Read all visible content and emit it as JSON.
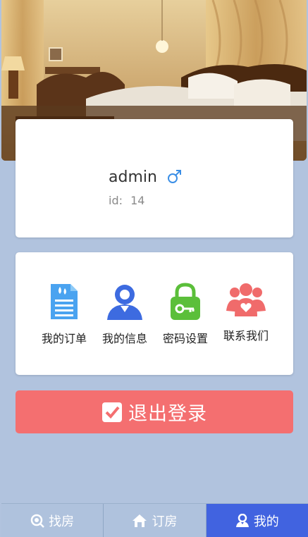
{
  "profile": {
    "username": "admin",
    "gender_symbol": "♂",
    "id_label": "id:",
    "id_value": "14"
  },
  "menu": {
    "items": [
      {
        "label": "我的订单",
        "icon": "document-icon",
        "color": "#4aa3f0"
      },
      {
        "label": "我的信息",
        "icon": "user-icon",
        "color": "#3d6be0"
      },
      {
        "label": "密码设置",
        "icon": "lock-icon",
        "color": "#5bbf3a"
      },
      {
        "label": "联系我们",
        "icon": "group-icon",
        "color": "#f06b6b"
      }
    ]
  },
  "logout": {
    "label": "退出登录",
    "icon": "check-square-icon",
    "color": "#f46f70"
  },
  "tabbar": {
    "items": [
      {
        "label": "找房",
        "icon": "search-icon",
        "active": false
      },
      {
        "label": "订房",
        "icon": "home-icon",
        "active": false
      },
      {
        "label": "我的",
        "icon": "user-icon",
        "active": true
      }
    ]
  },
  "colors": {
    "background": "#b1c3de",
    "accent": "#4163e0",
    "gender": "#3a8ee6"
  }
}
